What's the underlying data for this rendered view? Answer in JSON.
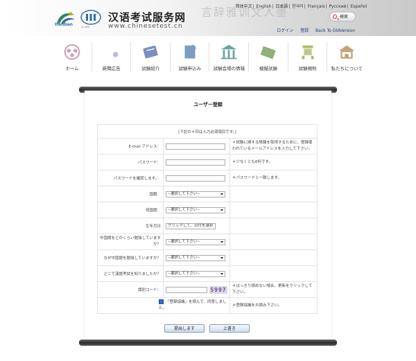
{
  "header": {
    "site_title": "汉语考试服务网",
    "site_url": "www.chinesetest.cn",
    "hanban_logo_text": "Hanban",
    "ci_logo_text": "孔子学院",
    "calligraphy": "言辞雅训文人墨",
    "languages": [
      "简体中文",
      "English",
      "日本語",
      "한국어",
      "Français",
      "Русский",
      "Español"
    ],
    "search_label": "検索",
    "user_links": [
      "ログイン",
      "登録",
      "Back To OldVersion"
    ]
  },
  "nav": {
    "items": [
      {
        "label": "ホーム",
        "icon": "home-icon",
        "color": "#c9a3b5"
      },
      {
        "label": "新聞広告",
        "icon": "news-icon",
        "color": "#9b86b3"
      },
      {
        "label": "試験紹介",
        "icon": "exam-intro-icon",
        "color": "#7d8fc0"
      },
      {
        "label": "試験申込み",
        "icon": "application-icon",
        "color": "#7d9cbf"
      },
      {
        "label": "試験会場の情報",
        "icon": "venue-icon",
        "color": "#6aa3a0"
      },
      {
        "label": "模擬試験",
        "icon": "mock-exam-icon",
        "color": "#8fb07a"
      },
      {
        "label": "試験規則",
        "icon": "rules-icon",
        "color": "#b1b86a"
      },
      {
        "label": "私たちについて",
        "icon": "about-icon",
        "color": "#c2a57a"
      }
    ]
  },
  "form": {
    "title": "ユーザー登録",
    "required_notice": "[下記の＊印は入力必須項目です。]",
    "email_label": "E-mail アドレス：",
    "email_value": "",
    "email_note": "＊試験に関する情報を取得するために、登録使われているメールアドレスを入力して下さい。",
    "password_label": "パスワード：",
    "password_value": "",
    "password_note": "＊少なくとも6桁です。",
    "confirm_label": "パスワードを確認します。：",
    "confirm_value": "",
    "confirm_note": "＊パスワードと一致します。",
    "country_label": "国籍：",
    "country_value": "--選択して下さい--",
    "native_lang_label": "母国語：",
    "native_lang_value": "--選択して下さい--",
    "birthday_label": "生年月日",
    "birthday_value": "クリックして、日付を選択",
    "study_length_label": "中国語をどのくらい勉強していますか？",
    "study_length_value": "--選択して下さい--",
    "reason_label": "なぜ中国語を勉強していますか？",
    "reason_value": "--選択して下さい--",
    "source_label": "どこで漢語考試を知りましたか？",
    "source_value": "--選択して下さい--",
    "captcha_label": "識別コード：",
    "captcha_value": "",
    "captcha_text": "5997",
    "captcha_note": "＊はっきり読めない場合、更新をクリックして下さい。",
    "agree_label": "「登録協議」を読んで、同意しました。",
    "agree_checked": true,
    "agree_note": "＊登録協議をお読み下さい。",
    "submit_label": "提出します",
    "reset_label": "上書き"
  }
}
